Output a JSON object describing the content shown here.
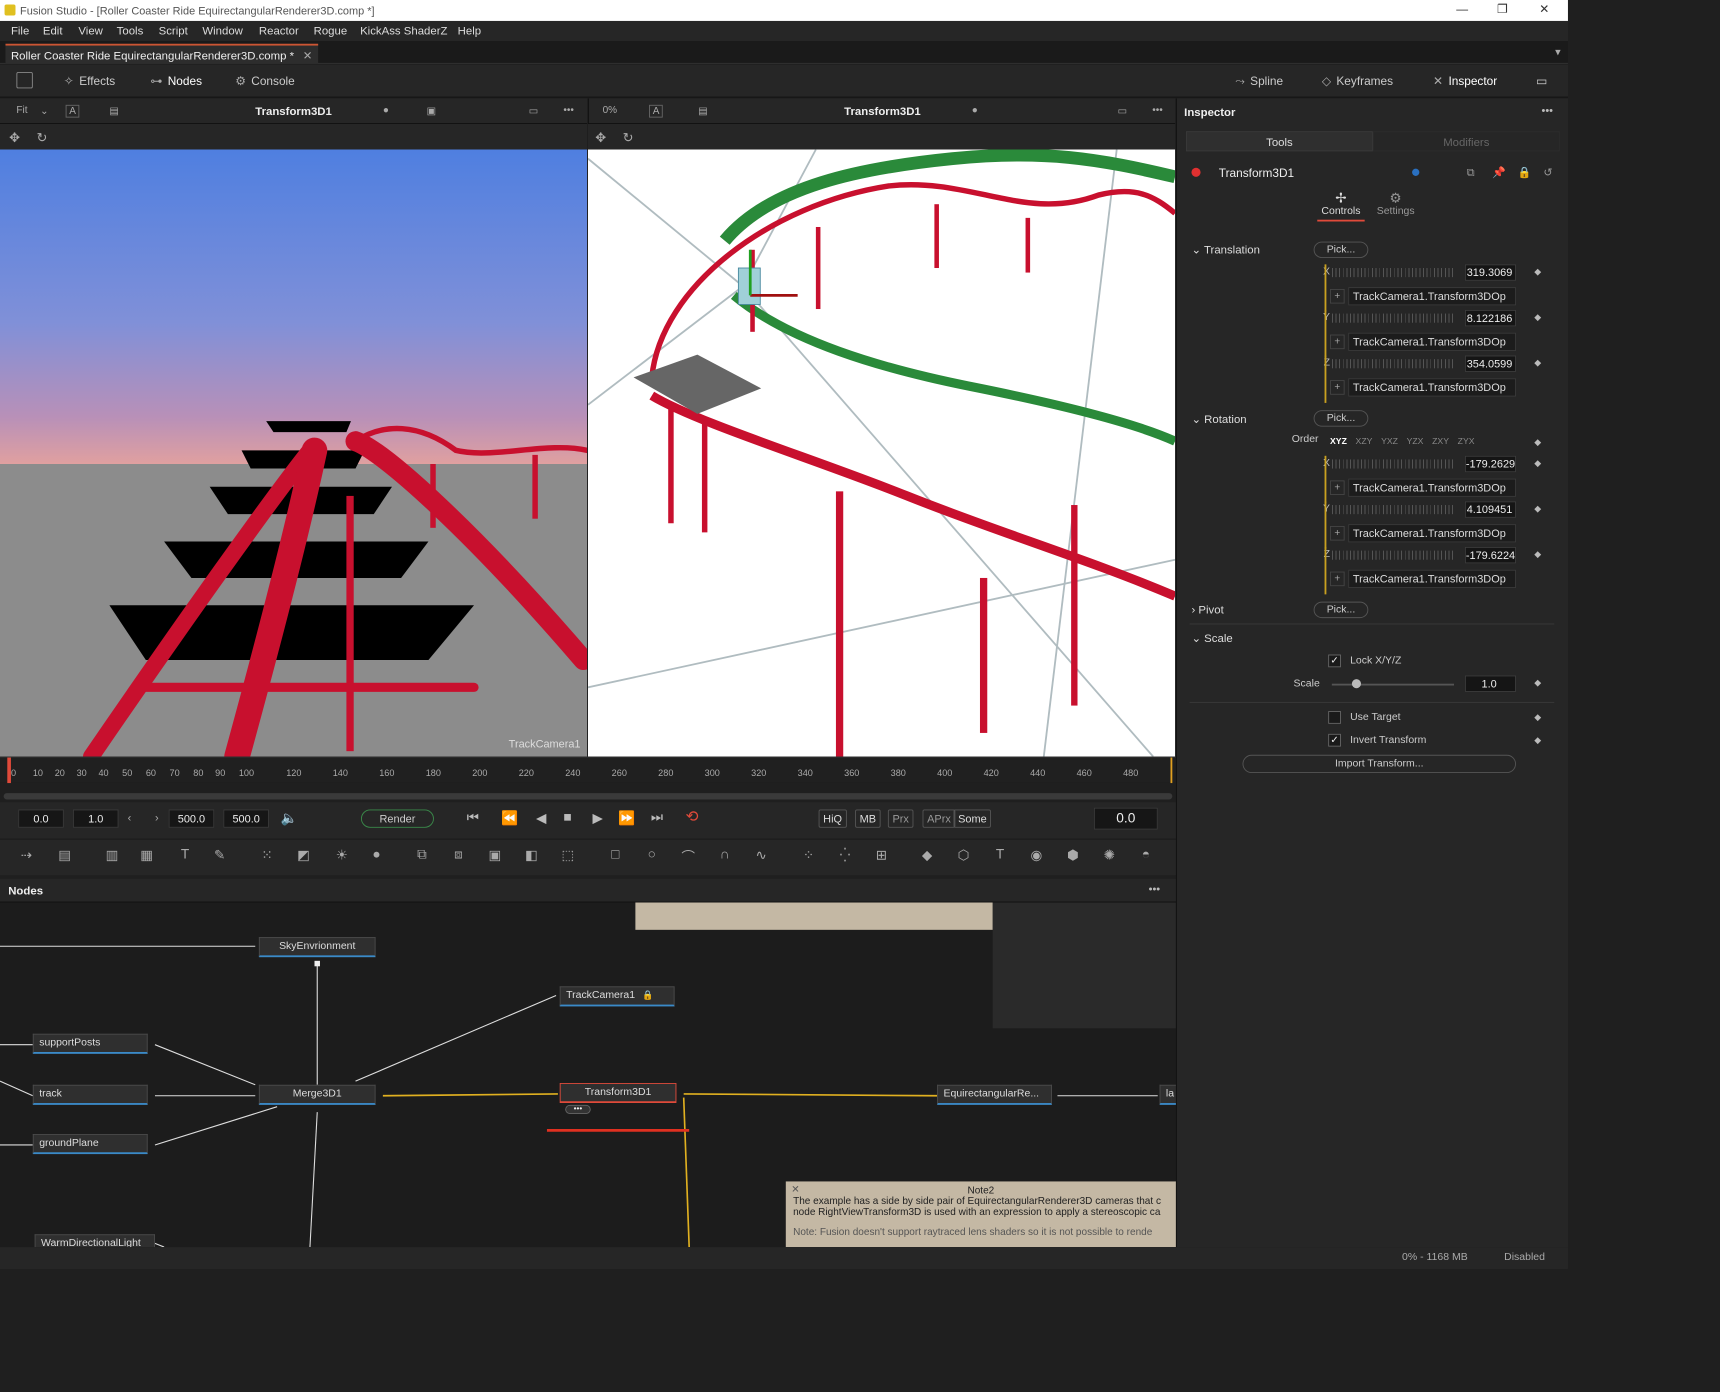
{
  "window": {
    "title": "Fusion Studio - [Roller Coaster Ride EquirectangularRenderer3D.comp *]",
    "tab": "Roller Coaster Ride EquirectangularRenderer3D.comp *"
  },
  "menu": [
    "File",
    "Edit",
    "View",
    "Tools",
    "Script",
    "Window",
    "Reactor",
    "Rogue",
    "KickAss ShaderZ",
    "Help"
  ],
  "toolbar": {
    "effects": "Effects",
    "nodes": "Nodes",
    "console": "Console",
    "spline": "Spline",
    "keyframes": "Keyframes",
    "inspector": "Inspector"
  },
  "viewer_left": {
    "fit": "Fit",
    "title": "Transform3D1",
    "label": "TrackCamera1"
  },
  "viewer_right": {
    "zoom": "0%",
    "title": "Transform3D1"
  },
  "ruler": [
    "0",
    "10",
    "20",
    "30",
    "40",
    "50",
    "60",
    "70",
    "80",
    "90",
    "100",
    "120",
    "140",
    "160",
    "180",
    "200",
    "220",
    "240",
    "260",
    "280",
    "300",
    "320",
    "340",
    "360",
    "380",
    "400",
    "420",
    "440",
    "460",
    "480"
  ],
  "transport": {
    "start": "0.0",
    "step": "1.0",
    "end": "500.0",
    "end2": "500.0",
    "render": "Render",
    "current": "0.0",
    "hiq": "HiQ",
    "mb": "MB",
    "prx": "Prx",
    "aprx": "APrx",
    "some": "Some"
  },
  "nodes_panel": {
    "title": "Nodes",
    "sky": "SkyEnvrionment",
    "track_camera": "TrackCamera1",
    "support_posts": "supportPosts",
    "track": "track",
    "ground_plane": "groundPlane",
    "merge": "Merge3D1",
    "transform": "Transform3D1",
    "equirect": "EquirectangularRe...",
    "la": "la",
    "warm_light": "WarmDirectionalLight",
    "note_title": "Note2",
    "note_line1": "The example has a side by side pair of EquirectangularRenderer3D cameras that c",
    "note_line2": "node RightViewTransform3D is used with an expression to apply a stereoscopic ca",
    "note_line3": "Note: Fusion doesn't support raytraced lens shaders so it is not possible to rende"
  },
  "inspector": {
    "title": "Inspector",
    "tools_tab": "Tools",
    "modifiers_tab": "Modifiers",
    "node_name": "Transform3D1",
    "controls": "Controls",
    "settings": "Settings",
    "translation": "Translation",
    "pick": "Pick...",
    "tx": "319.3069",
    "ty": "8.122186",
    "tz": "354.0599",
    "expr": "TrackCamera1.Transform3DOp",
    "rotation": "Rotation",
    "order": "Order",
    "orders": [
      "XYZ",
      "XZY",
      "YXZ",
      "YZX",
      "ZXY",
      "ZYX"
    ],
    "rx": "-179.2629",
    "ry": "4.109451",
    "rz": "-179.6224",
    "pivot": "Pivot",
    "scale_section": "Scale",
    "lock_xyz": "Lock X/Y/Z",
    "scale_label": "Scale",
    "scale_value": "1.0",
    "use_target": "Use Target",
    "invert_transform": "Invert Transform",
    "import_transform": "Import Transform...",
    "x": "X",
    "y": "Y",
    "z": "Z"
  },
  "status": {
    "memory": "0% - 1168 MB",
    "state": "Disabled"
  },
  "colors": {
    "accent": "#e04a3a",
    "track": "#c8102e",
    "green_track": "#2a8a3a",
    "sky_top": "#4f7fe0",
    "sky_bottom": "#c08aa0"
  }
}
